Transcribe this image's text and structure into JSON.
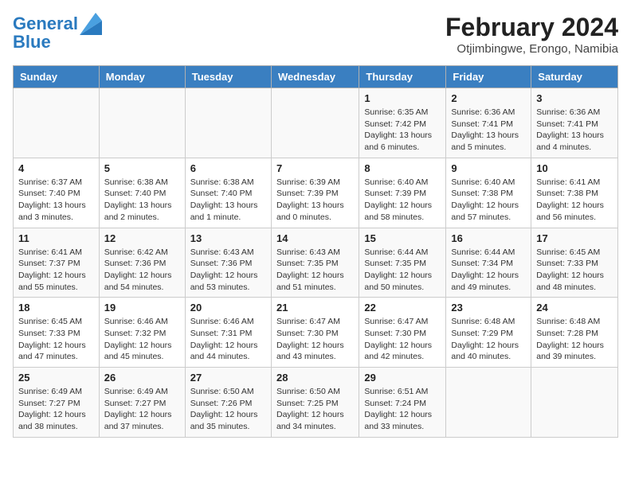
{
  "header": {
    "logo_line1": "General",
    "logo_line2": "Blue",
    "title": "February 2024",
    "subtitle": "Otjimbingwe, Erongo, Namibia"
  },
  "days_of_week": [
    "Sunday",
    "Monday",
    "Tuesday",
    "Wednesday",
    "Thursday",
    "Friday",
    "Saturday"
  ],
  "weeks": [
    [
      {
        "day": "",
        "sunrise": "",
        "sunset": "",
        "daylight": ""
      },
      {
        "day": "",
        "sunrise": "",
        "sunset": "",
        "daylight": ""
      },
      {
        "day": "",
        "sunrise": "",
        "sunset": "",
        "daylight": ""
      },
      {
        "day": "",
        "sunrise": "",
        "sunset": "",
        "daylight": ""
      },
      {
        "day": "1",
        "sunrise": "6:35 AM",
        "sunset": "7:42 PM",
        "daylight": "13 hours and 6 minutes."
      },
      {
        "day": "2",
        "sunrise": "6:36 AM",
        "sunset": "7:41 PM",
        "daylight": "13 hours and 5 minutes."
      },
      {
        "day": "3",
        "sunrise": "6:36 AM",
        "sunset": "7:41 PM",
        "daylight": "13 hours and 4 minutes."
      }
    ],
    [
      {
        "day": "4",
        "sunrise": "6:37 AM",
        "sunset": "7:40 PM",
        "daylight": "13 hours and 3 minutes."
      },
      {
        "day": "5",
        "sunrise": "6:38 AM",
        "sunset": "7:40 PM",
        "daylight": "13 hours and 2 minutes."
      },
      {
        "day": "6",
        "sunrise": "6:38 AM",
        "sunset": "7:40 PM",
        "daylight": "13 hours and 1 minute."
      },
      {
        "day": "7",
        "sunrise": "6:39 AM",
        "sunset": "7:39 PM",
        "daylight": "13 hours and 0 minutes."
      },
      {
        "day": "8",
        "sunrise": "6:40 AM",
        "sunset": "7:39 PM",
        "daylight": "12 hours and 58 minutes."
      },
      {
        "day": "9",
        "sunrise": "6:40 AM",
        "sunset": "7:38 PM",
        "daylight": "12 hours and 57 minutes."
      },
      {
        "day": "10",
        "sunrise": "6:41 AM",
        "sunset": "7:38 PM",
        "daylight": "12 hours and 56 minutes."
      }
    ],
    [
      {
        "day": "11",
        "sunrise": "6:41 AM",
        "sunset": "7:37 PM",
        "daylight": "12 hours and 55 minutes."
      },
      {
        "day": "12",
        "sunrise": "6:42 AM",
        "sunset": "7:36 PM",
        "daylight": "12 hours and 54 minutes."
      },
      {
        "day": "13",
        "sunrise": "6:43 AM",
        "sunset": "7:36 PM",
        "daylight": "12 hours and 53 minutes."
      },
      {
        "day": "14",
        "sunrise": "6:43 AM",
        "sunset": "7:35 PM",
        "daylight": "12 hours and 51 minutes."
      },
      {
        "day": "15",
        "sunrise": "6:44 AM",
        "sunset": "7:35 PM",
        "daylight": "12 hours and 50 minutes."
      },
      {
        "day": "16",
        "sunrise": "6:44 AM",
        "sunset": "7:34 PM",
        "daylight": "12 hours and 49 minutes."
      },
      {
        "day": "17",
        "sunrise": "6:45 AM",
        "sunset": "7:33 PM",
        "daylight": "12 hours and 48 minutes."
      }
    ],
    [
      {
        "day": "18",
        "sunrise": "6:45 AM",
        "sunset": "7:33 PM",
        "daylight": "12 hours and 47 minutes."
      },
      {
        "day": "19",
        "sunrise": "6:46 AM",
        "sunset": "7:32 PM",
        "daylight": "12 hours and 45 minutes."
      },
      {
        "day": "20",
        "sunrise": "6:46 AM",
        "sunset": "7:31 PM",
        "daylight": "12 hours and 44 minutes."
      },
      {
        "day": "21",
        "sunrise": "6:47 AM",
        "sunset": "7:30 PM",
        "daylight": "12 hours and 43 minutes."
      },
      {
        "day": "22",
        "sunrise": "6:47 AM",
        "sunset": "7:30 PM",
        "daylight": "12 hours and 42 minutes."
      },
      {
        "day": "23",
        "sunrise": "6:48 AM",
        "sunset": "7:29 PM",
        "daylight": "12 hours and 40 minutes."
      },
      {
        "day": "24",
        "sunrise": "6:48 AM",
        "sunset": "7:28 PM",
        "daylight": "12 hours and 39 minutes."
      }
    ],
    [
      {
        "day": "25",
        "sunrise": "6:49 AM",
        "sunset": "7:27 PM",
        "daylight": "12 hours and 38 minutes."
      },
      {
        "day": "26",
        "sunrise": "6:49 AM",
        "sunset": "7:27 PM",
        "daylight": "12 hours and 37 minutes."
      },
      {
        "day": "27",
        "sunrise": "6:50 AM",
        "sunset": "7:26 PM",
        "daylight": "12 hours and 35 minutes."
      },
      {
        "day": "28",
        "sunrise": "6:50 AM",
        "sunset": "7:25 PM",
        "daylight": "12 hours and 34 minutes."
      },
      {
        "day": "29",
        "sunrise": "6:51 AM",
        "sunset": "7:24 PM",
        "daylight": "12 hours and 33 minutes."
      },
      {
        "day": "",
        "sunrise": "",
        "sunset": "",
        "daylight": ""
      },
      {
        "day": "",
        "sunrise": "",
        "sunset": "",
        "daylight": ""
      }
    ]
  ],
  "colors": {
    "header_bg": "#3a7fc1",
    "header_text": "#ffffff",
    "border": "#cccccc"
  }
}
